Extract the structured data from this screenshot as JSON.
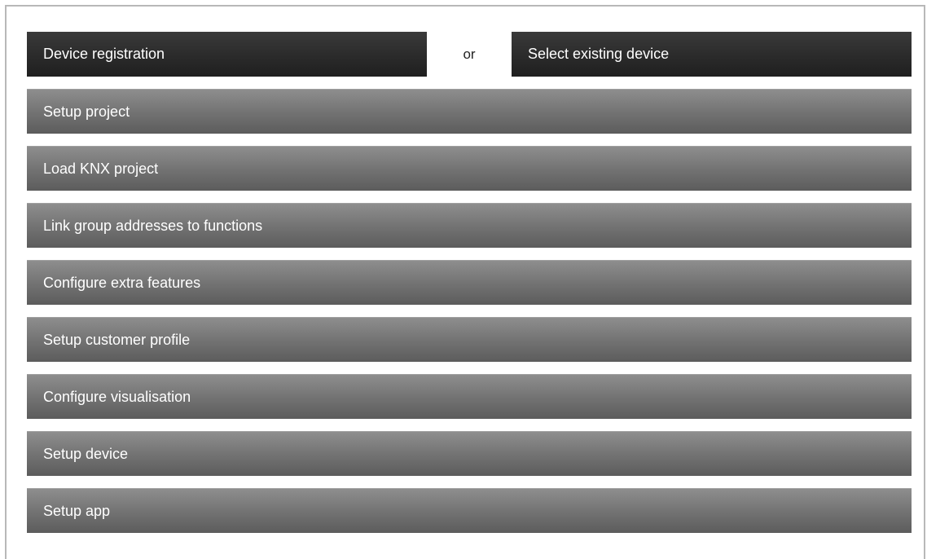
{
  "top": {
    "device_registration_label": "Device registration",
    "or_label": "or",
    "select_existing_label": "Select existing device"
  },
  "steps": [
    {
      "label": "Setup project"
    },
    {
      "label": "Load KNX project"
    },
    {
      "label": "Link group addresses to functions"
    },
    {
      "label": "Configure extra features"
    },
    {
      "label": "Setup customer profile"
    },
    {
      "label": "Configure visualisation"
    },
    {
      "label": "Setup device"
    },
    {
      "label": "Setup app"
    }
  ],
  "colors": {
    "dark_button": "#2c2c2c",
    "step_button": "#767676",
    "text": "#ffffff"
  }
}
